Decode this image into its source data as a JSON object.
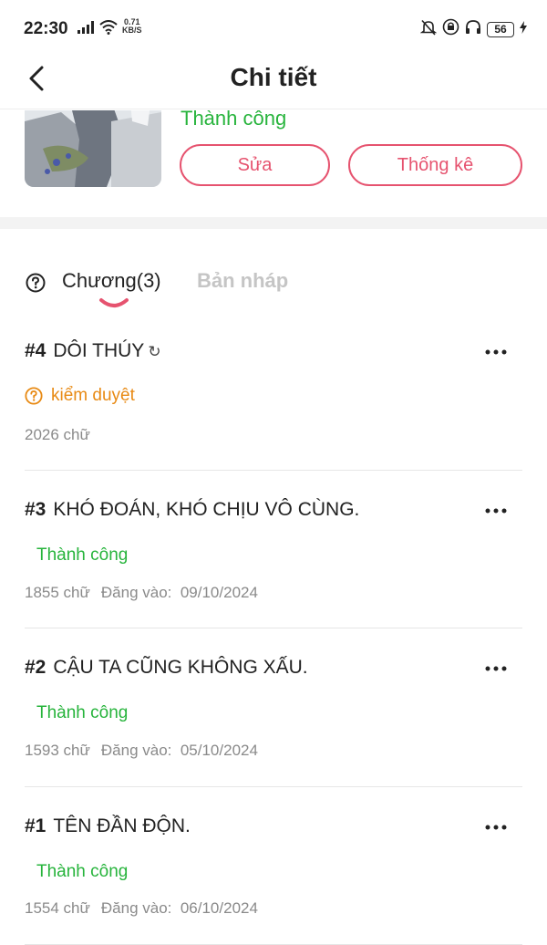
{
  "status_bar": {
    "time": "22:30",
    "speed_value": "0.71",
    "speed_unit": "KB/S",
    "battery": "56"
  },
  "header": {
    "title": "Chi tiết"
  },
  "story": {
    "status": "Thành công",
    "edit_label": "Sửa",
    "stats_label": "Thống kê"
  },
  "tabs": {
    "chapters_label": "Chương(3)",
    "drafts_label": "Bản nháp"
  },
  "chapters": [
    {
      "number": "#4",
      "title": "DÔI THÚY",
      "status": "kiểm duyệt",
      "word_count": "2026 chữ",
      "posted_label": "",
      "posted_date": ""
    },
    {
      "number": "#3",
      "title": "KHÓ ĐOÁN, KHÓ CHỊU VÔ CÙNG.",
      "status": "Thành công",
      "word_count": "1855 chữ",
      "posted_label": "Đăng vào:",
      "posted_date": "09/10/2024"
    },
    {
      "number": "#2",
      "title": "CẬU TA CŨNG KHÔNG XẤU.",
      "status": "Thành công",
      "word_count": "1593 chữ",
      "posted_label": "Đăng vào:",
      "posted_date": "05/10/2024"
    },
    {
      "number": "#1",
      "title": "TÊN ĐẦN ĐỘN.",
      "status": "Thành công",
      "word_count": "1554 chữ",
      "posted_label": "Đăng vào:",
      "posted_date": "06/10/2024"
    }
  ],
  "colors": {
    "accent": "#e6536f",
    "success": "#27b43c",
    "pending": "#e88a14",
    "muted": "#8a8a8a"
  },
  "icons": {
    "back": "chevron-left-icon",
    "help": "question-circle-icon",
    "more": "more-horizontal-icon",
    "pending": "question-circle-icon",
    "refresh": "refresh-icon"
  }
}
